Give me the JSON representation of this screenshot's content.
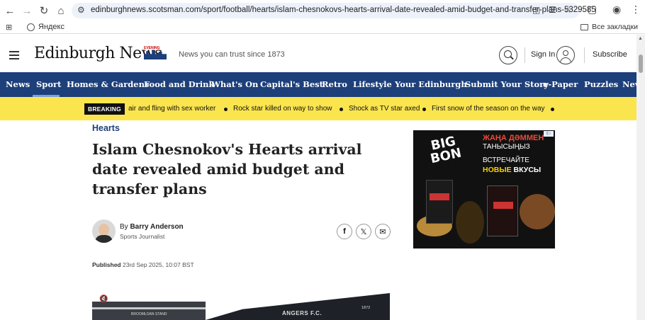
{
  "browser": {
    "url": "edinburghnews.scotsman.com/sport/football/hearts/islam-chesnokovs-hearts-arrival-date-revealed-amid-budget-and-transfer-plans-5329585",
    "bookmark_yandex": "Яндекс",
    "bookmark_all": "Все закладки"
  },
  "header": {
    "logo": "Edinburgh News",
    "logo_badge": "EVENING",
    "tagline": "News you can trust since 1873",
    "signin": "Sign In",
    "subscribe": "Subscribe"
  },
  "nav": {
    "items": [
      "News",
      "Sport",
      "Homes & Gardens",
      "Food and Drink",
      "What's On",
      "Capital's Best",
      "Retro",
      "Lifestyle",
      "Your Edinburgh",
      "Submit Your Story",
      "e-Paper",
      "Puzzles",
      "News"
    ],
    "active": "Sport"
  },
  "breaking": {
    "label": "BREAKING",
    "items": [
      "air and fling with sex worker",
      "Rock star killed on way to show",
      "Shock as TV star axed",
      "First snow of the season on the way"
    ]
  },
  "article": {
    "category": "Hearts",
    "headline": "Islam Chesnokov's Hearts arrival date revealed amid budget and transfer plans",
    "author_prefix": "By",
    "author": "Barry Anderson",
    "author_role": "Sports Journalist",
    "published_label": "Published",
    "published_date": "23rd Sep 2025, 10:07 BST",
    "video_text": "ANGERS F.C.",
    "video_year": "1872",
    "video_small": "BROOMLOAN STAND"
  },
  "ad": {
    "brand_line1": "BIG",
    "brand_line2": "BON",
    "line1": "ЖАҢА ДӘММЕН",
    "line2": "ТАНЫСЫҢЫЗ",
    "line3": "ВСТРЕЧАЙТЕ",
    "line4a": "НОВЫЕ",
    "line4b": " ВКУСЫ"
  }
}
